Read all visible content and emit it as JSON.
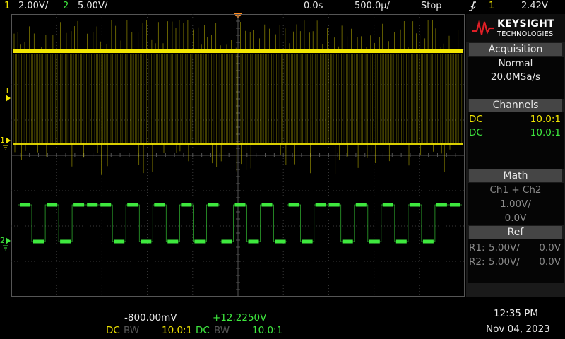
{
  "header": {
    "ch1_num": "1",
    "ch1_scale": "2.00V/",
    "ch2_num": "2",
    "ch2_scale": "5.00V/",
    "time_delay": "0.0s",
    "time_scale": "500.0µ/",
    "run_state": "Stop",
    "trigger_icon": "falling-edge-icon",
    "trigger_source": "1",
    "trigger_level": "2.42V"
  },
  "markers": {
    "trigger": "T",
    "ch1_ground": "1",
    "ch2_ground": "2"
  },
  "brand": {
    "name": "KEYSIGHT",
    "sub": "TECHNOLOGIES",
    "icon": "keysight-wave-icon"
  },
  "acquisition": {
    "title": "Acquisition",
    "mode": "Normal",
    "rate": "20.0MSa/s"
  },
  "channels": {
    "title": "Channels",
    "rows": [
      {
        "coupling": "DC",
        "probe": "10.0:1"
      },
      {
        "coupling": "DC",
        "probe": "10.0:1"
      }
    ]
  },
  "math": {
    "title": "Math",
    "expr": "Ch1 + Ch2",
    "scale": "1.00V/",
    "offset": "0.0V"
  },
  "ref": {
    "title": "Ref",
    "rows": [
      {
        "name": "R1:",
        "scale": "5.00V/",
        "offset": "0.0V"
      },
      {
        "name": "R2:",
        "scale": "5.00V/",
        "offset": "0.0V"
      }
    ]
  },
  "footer": {
    "ch1_offset": "-800.00mV",
    "ch2_offset": "+12.2250V",
    "ch1_coupling": "DC",
    "ch1_bw": "BW",
    "ch1_probe": "10.0:1",
    "ch2_coupling": "DC",
    "ch2_bw": "BW",
    "ch2_probe": "10.0:1",
    "time": "12:35 PM",
    "date": "Nov 04, 2023"
  },
  "colors": {
    "ch1": "#f2e600",
    "ch2": "#3ee83e",
    "trigger_marker": "#ff8a1e",
    "grid": "#3a3a3a"
  },
  "ch2_pattern": [
    1,
    0,
    1,
    0,
    1,
    1,
    1,
    0,
    1,
    0,
    1,
    0,
    1,
    0,
    1,
    0,
    1,
    0,
    1,
    0,
    1,
    0,
    1,
    1,
    0,
    1,
    0,
    1,
    0,
    1,
    0,
    1,
    1
  ]
}
